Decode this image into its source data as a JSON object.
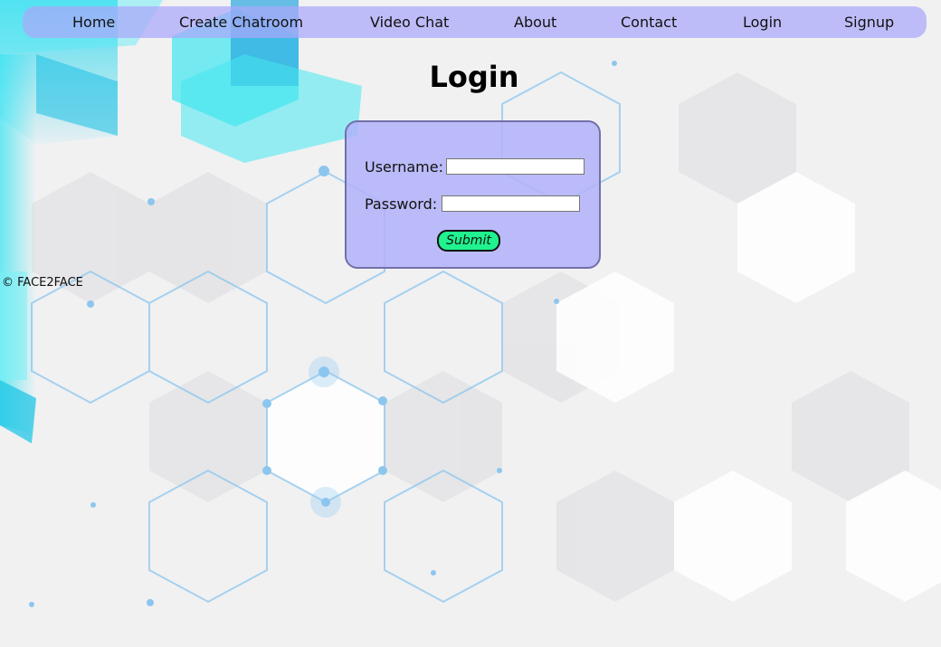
{
  "nav": {
    "home": "Home",
    "create_chatroom": "Create Chatroom",
    "video_chat": "Video Chat",
    "about": "About",
    "contact": "Contact",
    "login": "Login",
    "signup": "Signup"
  },
  "page": {
    "title": "Login"
  },
  "form": {
    "username_label": "Username:",
    "username_value": "",
    "password_label": "Password:",
    "password_value": "",
    "submit_label": "Submit"
  },
  "footer": {
    "text": "© FACE2FACE"
  },
  "colors": {
    "navbar": "#aaa8fa",
    "card": "#b2b2fa",
    "card_border": "#7370a8",
    "submit": "#1ff28f",
    "accent_cyan": "#3ee6f0",
    "hex_line": "#8cc6ee"
  }
}
